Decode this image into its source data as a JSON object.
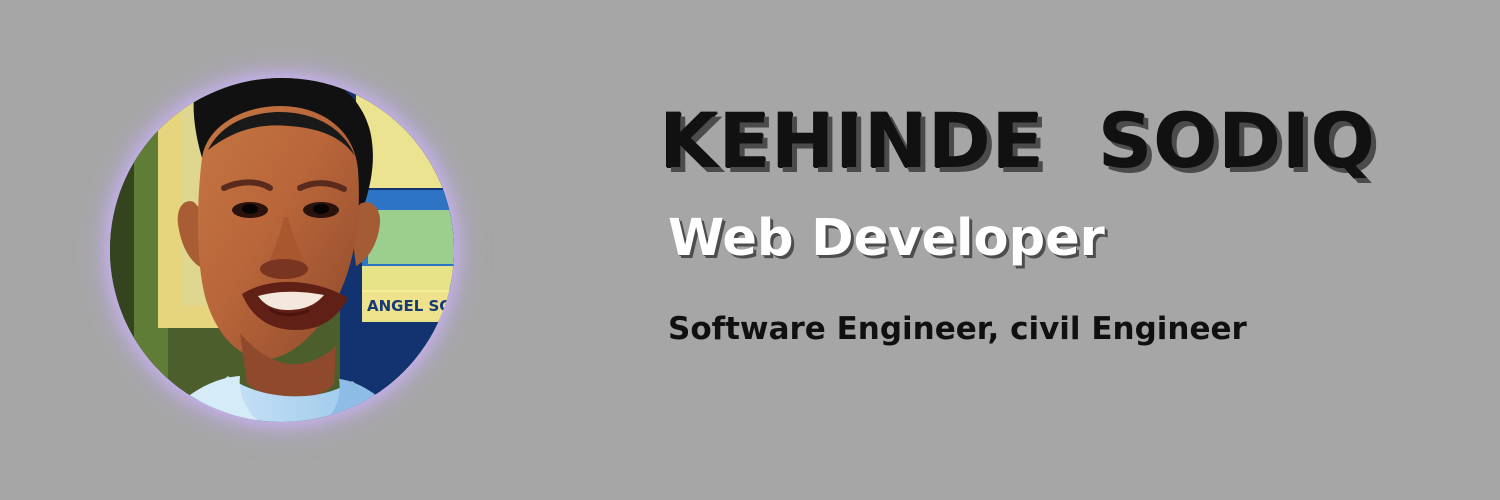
{
  "banner": {
    "background_color": "#a6a6a6",
    "glow_color": "#d8c4ff"
  },
  "profile": {
    "photo_sign_text": "ANGEL SC",
    "name": "KEHINDE  SODIQ",
    "role": "Web Developer",
    "tagline": "Software Engineer, civil Engineer"
  }
}
